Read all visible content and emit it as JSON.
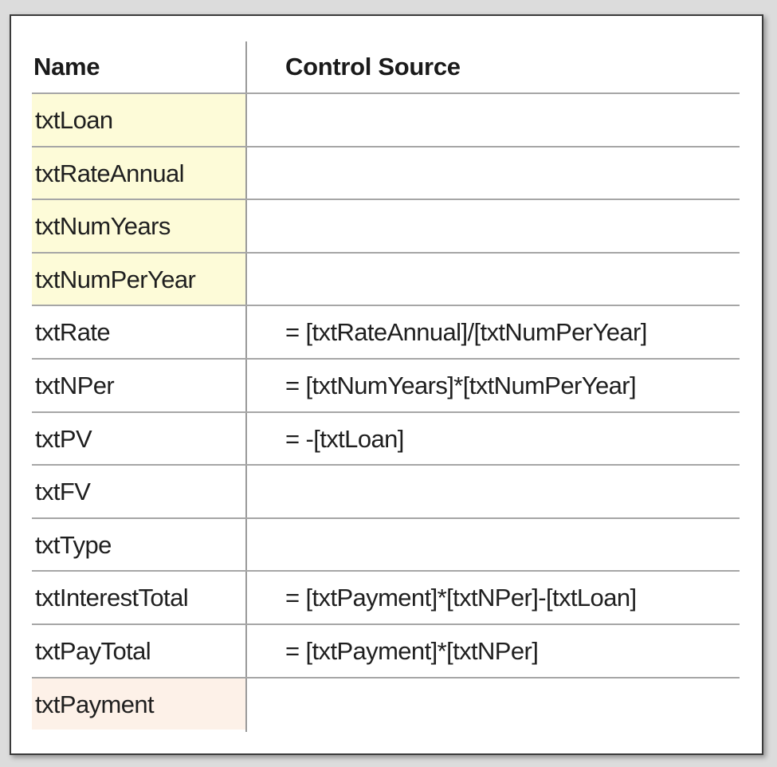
{
  "table": {
    "headers": {
      "name": "Name",
      "control_source": "Control Source"
    },
    "colors": {
      "input_highlight": "#fdfbd8",
      "output_highlight": "#fdf1e8"
    },
    "rows": [
      {
        "name": "txtLoan",
        "control_source": "",
        "highlight": "input"
      },
      {
        "name": "txtRateAnnual",
        "control_source": "",
        "highlight": "input"
      },
      {
        "name": "txtNumYears",
        "control_source": "",
        "highlight": "input"
      },
      {
        "name": "txtNumPerYear",
        "control_source": "",
        "highlight": "input"
      },
      {
        "name": "txtRate",
        "control_source": "= [txtRateAnnual]/[txtNumPerYear]",
        "highlight": "none"
      },
      {
        "name": "txtNPer",
        "control_source": "= [txtNumYears]*[txtNumPerYear]",
        "highlight": "none"
      },
      {
        "name": "txtPV",
        "control_source": "= -[txtLoan]",
        "highlight": "none"
      },
      {
        "name": "txtFV",
        "control_source": "",
        "highlight": "none"
      },
      {
        "name": "txtType",
        "control_source": "",
        "highlight": "none"
      },
      {
        "name": "txtInterestTotal",
        "control_source": "= [txtPayment]*[txtNPer]-[txtLoan]",
        "highlight": "none"
      },
      {
        "name": "txtPayTotal",
        "control_source": "= [txtPayment]*[txtNPer]",
        "highlight": "none"
      },
      {
        "name": "txtPayment",
        "control_source": "",
        "highlight": "output"
      }
    ]
  }
}
